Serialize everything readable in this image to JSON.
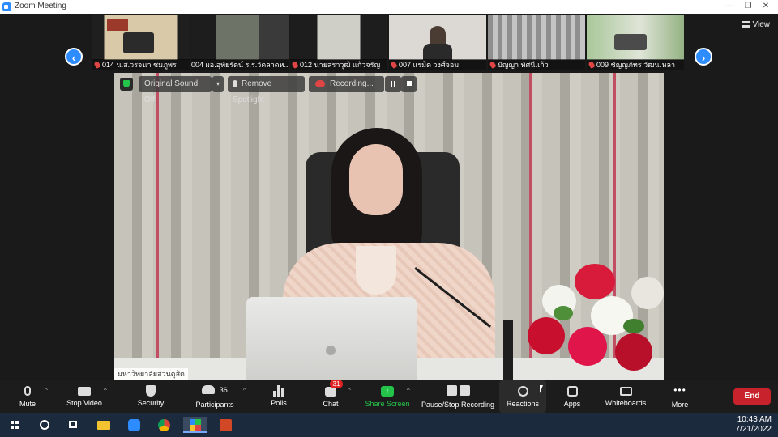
{
  "window": {
    "title": "Zoom Meeting",
    "minimize": "—",
    "restore": "❐",
    "close": "✕"
  },
  "view_label": "View",
  "thumbnails": [
    {
      "label": "014 น.ส.วรจนา ชมภูพร"
    },
    {
      "label": "004  ผอ.อุทัยรัตน์ ร.ร.วัดลาดห..."
    },
    {
      "label": "012 นายสราวุฒิ  แก้วจรัญ"
    },
    {
      "label": "007 แรมิต วงศ์จอม"
    },
    {
      "label": "ปัญญา  ทัศนีแก้ว"
    },
    {
      "label": "009 ชัญญภัทร วัฒนเหลา"
    }
  ],
  "spotlight": {
    "original_sound": "Original Sound: Off",
    "remove_spotlight": "Remove Spotlight",
    "recording": "Recording...",
    "nameplate": "มหาวิทยาลัยสวนดุสิต"
  },
  "toolbar": {
    "mute": "Mute",
    "stop_video": "Stop Video",
    "security": "Security",
    "participants": "Participants",
    "participants_count": "36",
    "polls": "Polls",
    "chat": "Chat",
    "chat_badge": "31",
    "share_screen": "Share Screen",
    "pause_stop_recording": "Pause/Stop Recording",
    "reactions": "Reactions",
    "apps": "Apps",
    "whiteboards": "Whiteboards",
    "more": "More",
    "end": "End"
  },
  "taskbar": {
    "time": "10:43 AM",
    "date": "7/21/2022"
  },
  "colors": {
    "zoom_blue": "#2d8cff",
    "share_green": "#24c44b",
    "end_red": "#c8232c",
    "badge_red": "#e02424"
  }
}
